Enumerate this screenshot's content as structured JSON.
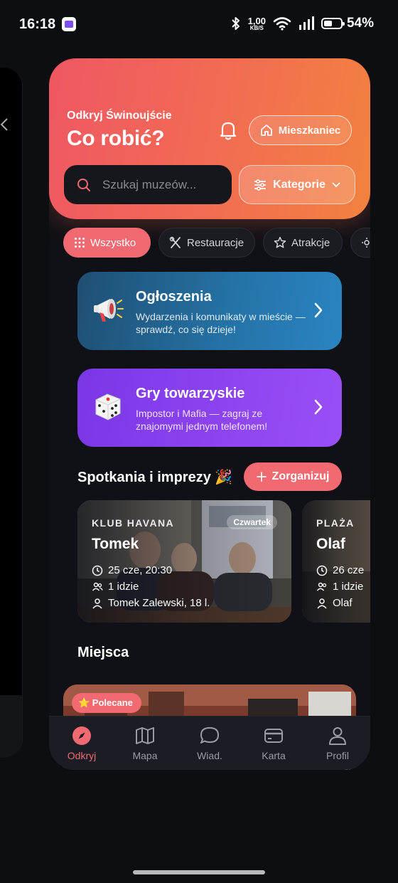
{
  "status_bar": {
    "time": "16:18",
    "speed_value": "1,00",
    "speed_unit": "KB/S",
    "battery": "54%"
  },
  "hero": {
    "subtitle": "Odkryj Świnoujście",
    "title": "Co robić?",
    "resident_label": "Mieszkaniec",
    "search_placeholder": "Szukaj muzeów...",
    "categories_label": "Kategorie"
  },
  "chips": [
    {
      "label": "Wszystko",
      "icon": "grid-icon",
      "active": true
    },
    {
      "label": "Restauracje",
      "icon": "cutlery-icon",
      "active": false
    },
    {
      "label": "Atrakcje",
      "icon": "star-icon",
      "active": false
    }
  ],
  "promos": [
    {
      "title": "Ogłoszenia",
      "description": "Wydarzenia i komunikaty w mieście — sprawdź, co się dzieje!",
      "icon": "megaphone-icon",
      "color": "#2574a8"
    },
    {
      "title": "Gry towarzyskie",
      "description": "Impostor i Mafia — zagraj ze znajomymi jednym telefonem!",
      "icon": "dice-icon",
      "color": "#8f45f0"
    }
  ],
  "meetups": {
    "title": "Spotkania i imprezy 🎉",
    "organize_label": "Zorganizuj",
    "events": [
      {
        "venue": "KLUB HAVANA",
        "name": "Tomek",
        "badge": "Czwartek",
        "datetime": "25 cze, 20:30",
        "attendees": "1 idzie",
        "host": "Tomek Zalewski, 18 l."
      },
      {
        "venue": "PLAŻA",
        "name": "Olaf",
        "datetime": "26 cze",
        "attendees": "1 idzie",
        "host": "Olaf"
      }
    ]
  },
  "places": {
    "title": "Miejsca",
    "featured_label": "⭐ Polecane"
  },
  "nav": {
    "items": [
      {
        "label": "Odkryj",
        "icon": "compass-icon",
        "active": true
      },
      {
        "label": "Mapa",
        "icon": "map-icon",
        "active": false
      },
      {
        "label": "Wiad.",
        "icon": "chat-icon",
        "active": false
      },
      {
        "label": "Karta",
        "icon": "card-icon",
        "active": false
      },
      {
        "label": "Profil",
        "icon": "user-icon",
        "active": false
      }
    ]
  },
  "colors": {
    "accent": "#f16a72",
    "hero_start": "#ef5763",
    "hero_end": "#f2823f",
    "background": "#101116"
  }
}
